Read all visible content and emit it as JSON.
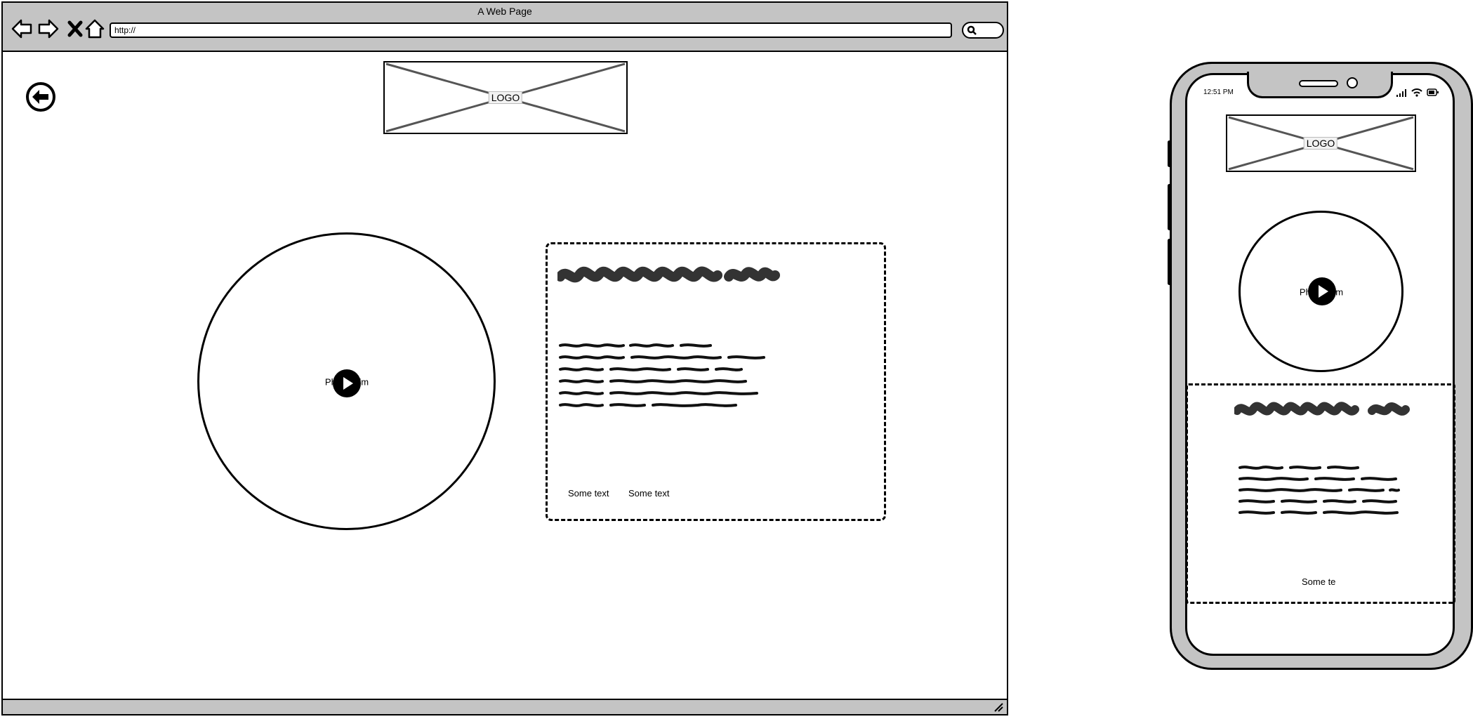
{
  "desktop": {
    "browser": {
      "title": "A Web Page",
      "url": "http://",
      "nav_icons": [
        "back-arrow-icon",
        "forward-arrow-icon",
        "close-x-icon",
        "home-icon"
      ],
      "search_icon": "search-icon",
      "resize_icon": "resize-grip-icon"
    },
    "back_button_icon": "circle-back-arrow-icon",
    "logo": {
      "label": "LOGO"
    },
    "video": {
      "label": "Photo Film",
      "icon": "play-icon"
    },
    "card": {
      "captions": [
        "Some text",
        "Some text"
      ]
    }
  },
  "mobile": {
    "status_time": "12:51 PM",
    "status_icons": [
      "signal-icon",
      "wifi-icon",
      "battery-icon"
    ],
    "logo": {
      "label": "LOGO"
    },
    "video": {
      "label": "Photo Film",
      "icon": "play-icon"
    },
    "card": {
      "caption": "Some te"
    }
  },
  "colors": {
    "chrome_gray": "#c4c4c4",
    "ink": "#000000",
    "scribble": "#333333",
    "placeholder_line": "#555555"
  }
}
